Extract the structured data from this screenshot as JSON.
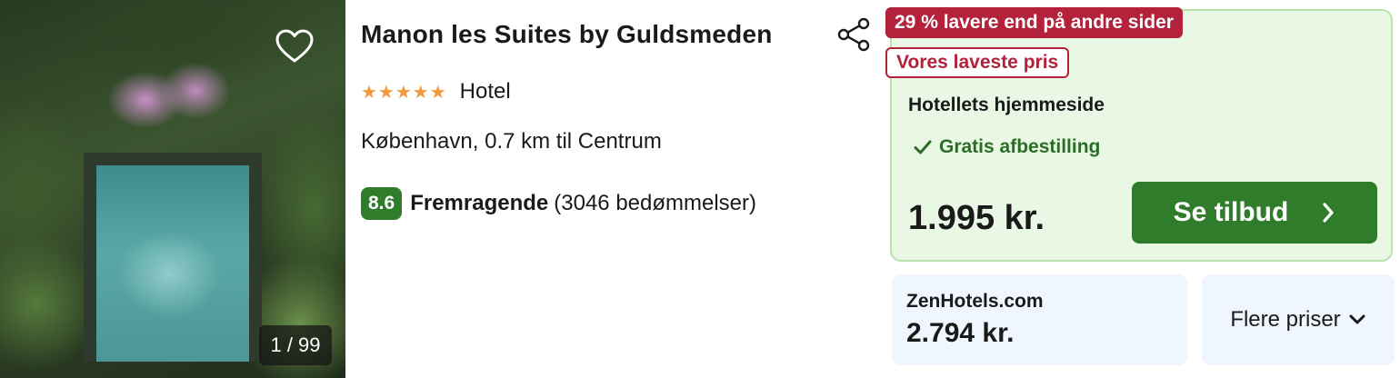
{
  "hotel": {
    "name": "Manon les Suites by Guldsmeden",
    "stars": "★★★★★",
    "star_count": 5,
    "type": "Hotel",
    "location": "København, 0.7 km til Centrum",
    "rating": "8.6",
    "rating_label": "Fremragende",
    "reviews": "(3046 bedømmelser)"
  },
  "gallery": {
    "counter": "1 / 99"
  },
  "deal": {
    "discount_badge": "29 % lavere end på andre sider",
    "lowest_badge": "Vores laveste pris",
    "provider": "Hotellets hjemmeside",
    "cancellation": "Gratis afbestilling",
    "price": "1.995 kr.",
    "button_label": "Se tilbud"
  },
  "alt_offer": {
    "provider": "ZenHotels.com",
    "price": "2.794 kr."
  },
  "more_prices_label": "Flere priser",
  "colors": {
    "accent_green": "#2f7d2a",
    "badge_red": "#b3223a",
    "star_orange": "#f09a3e",
    "deal_bg": "#e9f7e5",
    "alt_bg": "#f0f6fd"
  },
  "icons": {
    "favorite": "heart-icon",
    "share": "share-icon",
    "cancel": "check-icon",
    "button": "chevron-right-icon",
    "more": "chevron-down-icon"
  }
}
